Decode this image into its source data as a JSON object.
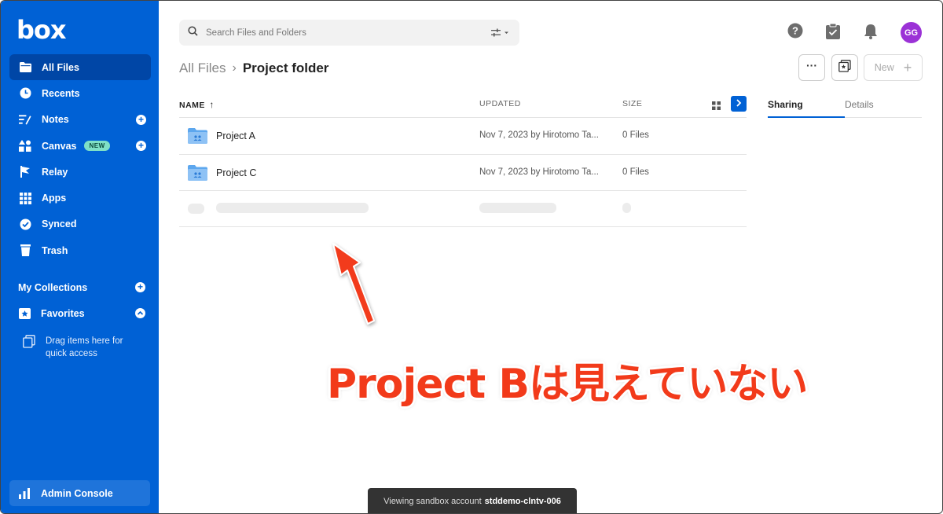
{
  "app": {
    "logo": "box"
  },
  "sidebar": {
    "items": [
      {
        "label": "All Files",
        "icon": "folder-icon"
      },
      {
        "label": "Recents",
        "icon": "clock-icon"
      },
      {
        "label": "Notes",
        "icon": "notes-icon"
      },
      {
        "label": "Canvas",
        "icon": "canvas-icon",
        "badge": "NEW"
      },
      {
        "label": "Relay",
        "icon": "relay-icon"
      },
      {
        "label": "Apps",
        "icon": "apps-grid-icon"
      },
      {
        "label": "Synced",
        "icon": "check-circle-icon"
      },
      {
        "label": "Trash",
        "icon": "trash-icon"
      }
    ],
    "collections_label": "My Collections",
    "favorites_label": "Favorites",
    "drag_hint": "Drag items here for quick access",
    "admin_label": "Admin Console"
  },
  "search": {
    "placeholder": "Search Files and Folders"
  },
  "user": {
    "initials": "GG",
    "avatar_color": "#9b32d6"
  },
  "breadcrumb": {
    "root": "All Files",
    "current": "Project folder"
  },
  "toolbar": {
    "more_label": "···",
    "new_label": "New",
    "new_plus": "+"
  },
  "table": {
    "headers": {
      "name": "NAME",
      "name_sort": "↑",
      "updated": "UPDATED",
      "size": "SIZE"
    },
    "rows": [
      {
        "name": "Project A",
        "updated": "Nov 7, 2023 by Hirotomo Ta...",
        "size": "0 Files"
      },
      {
        "name": "Project C",
        "updated": "Nov 7, 2023 by Hirotomo Ta...",
        "size": "0 Files"
      }
    ]
  },
  "side_panel": {
    "tabs": [
      "Sharing",
      "Details"
    ]
  },
  "annotation": {
    "text": "Project Bは見えていない",
    "color": "#f23a1a"
  },
  "toast": {
    "prefix": "Viewing sandbox account",
    "account": "stddemo-clntv-006"
  },
  "colors": {
    "brand": "#0061d5"
  }
}
